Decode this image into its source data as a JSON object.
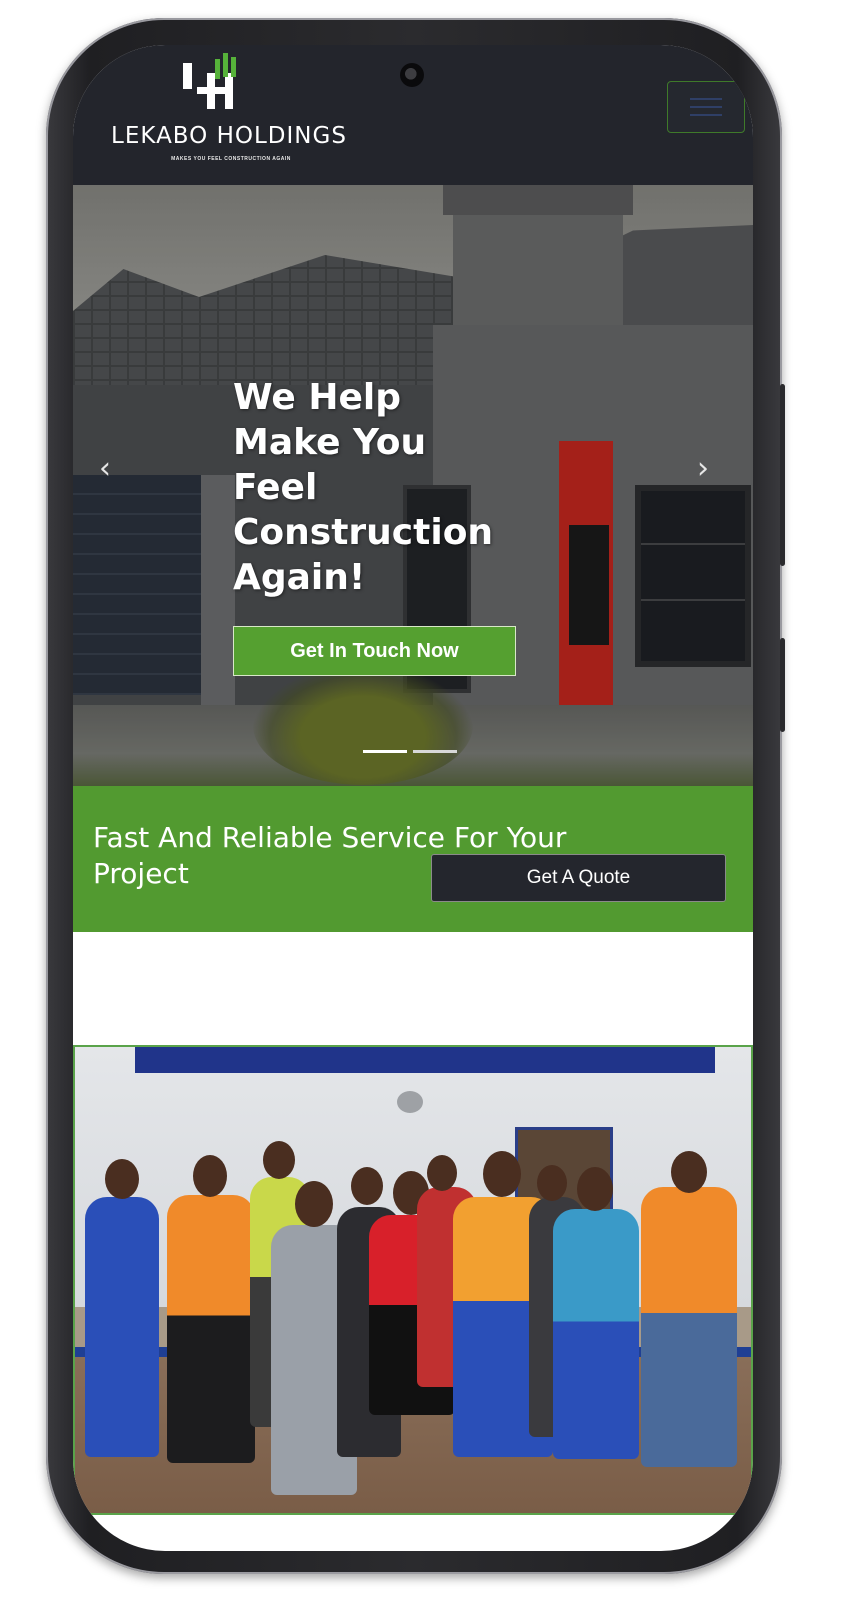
{
  "brand": {
    "name": "LEKABO HOLDINGS",
    "tagline": "MAKES YOU FEEL CONSTRUCTION AGAIN",
    "logo_mark": "LH"
  },
  "header": {
    "menu_icon": "hamburger-icon"
  },
  "hero": {
    "title_lines": [
      "We Help",
      "Make You",
      "Feel",
      "Construction",
      "Again!"
    ],
    "cta_label": "Get In Touch Now",
    "prev_icon": "chevron-left-icon",
    "next_icon": "chevron-right-icon",
    "slide_count": 2,
    "active_slide": 1
  },
  "band": {
    "headline": "Fast And Reliable Service For Your Project",
    "quote_label": "Get A Quote"
  },
  "colors": {
    "accent_green": "#529a30",
    "header_dark": "#23252c",
    "button_dark": "#24262d"
  }
}
